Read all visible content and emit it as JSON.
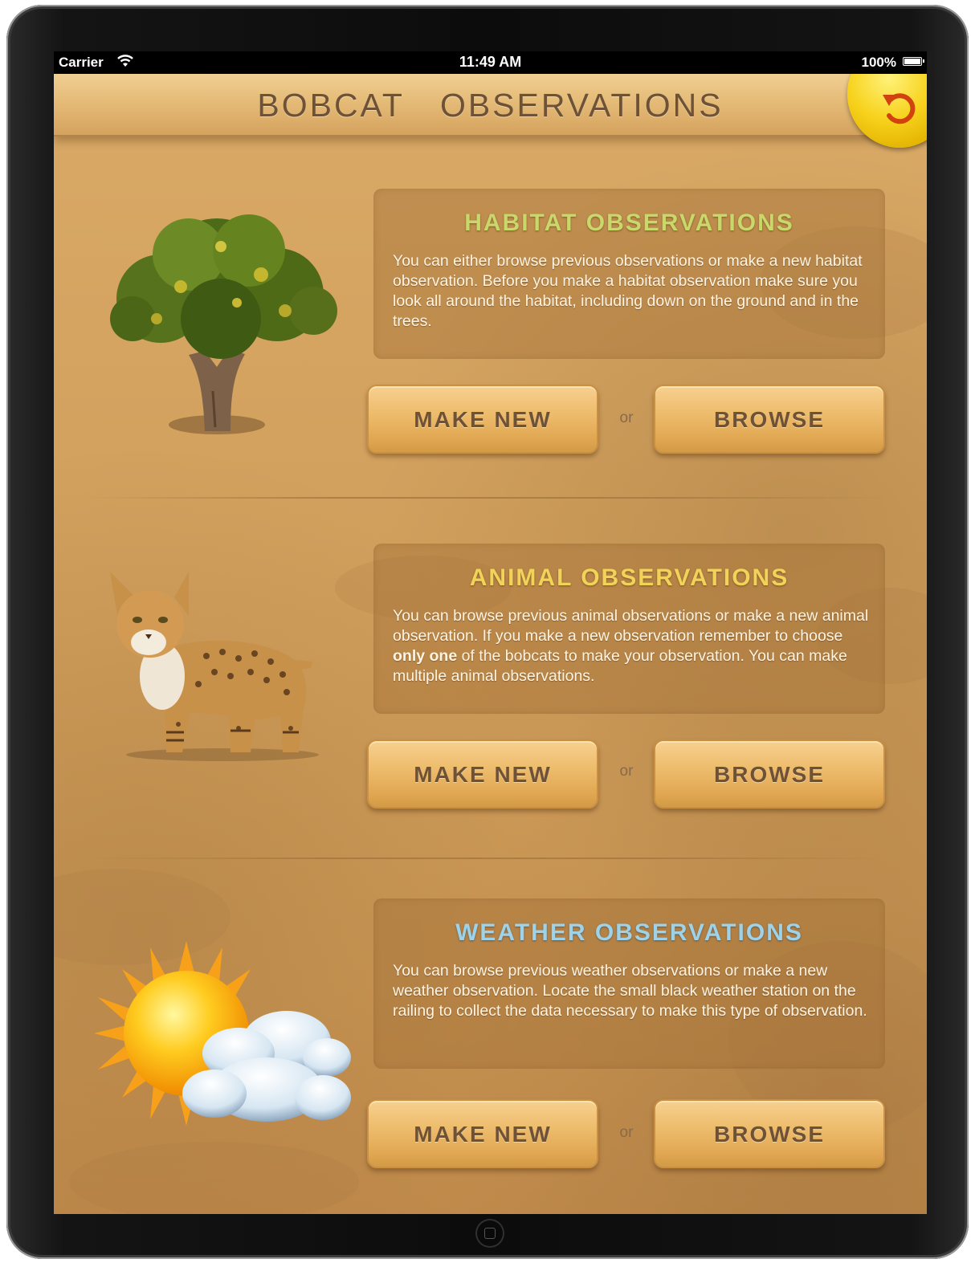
{
  "status_bar": {
    "carrier": "Carrier",
    "time": "11:49 AM",
    "battery": "100%"
  },
  "header": {
    "title": "BOBCAT  OBSERVATIONS",
    "back_icon": "undo-arrow-icon"
  },
  "sections": [
    {
      "heading": "HABITAT OBSERVATIONS",
      "heading_color": "#c9d86a",
      "body": "You can either browse previous observations or make a new habitat observation. Before you make a habitat observation make sure you look all around the habitat, including down on the ground and in the trees.",
      "icon": "tree-icon",
      "make_new_label": "MAKE NEW",
      "or_label": "or",
      "browse_label": "BROWSE"
    },
    {
      "heading": "ANIMAL OBSERVATIONS",
      "heading_color": "#f2d35a",
      "body_pre": "You can browse previous animal observations or make a new animal observation. If you make a new observation remember to choose ",
      "body_bold": "only one",
      "body_post": " of the bobcats to make your observation. You can make multiple animal observations.",
      "icon": "bobcat-icon",
      "make_new_label": "MAKE NEW",
      "or_label": "or",
      "browse_label": "BROWSE"
    },
    {
      "heading": "WEATHER OBSERVATIONS",
      "heading_color": "#9ed2e8",
      "body": "You can browse previous weather observations or make a new weather observation. Locate the small black weather station on the railing to collect the data necessary to make this type of observation.",
      "icon": "sun-cloud-icon",
      "make_new_label": "MAKE NEW",
      "or_label": "or",
      "browse_label": "BROWSE"
    }
  ]
}
